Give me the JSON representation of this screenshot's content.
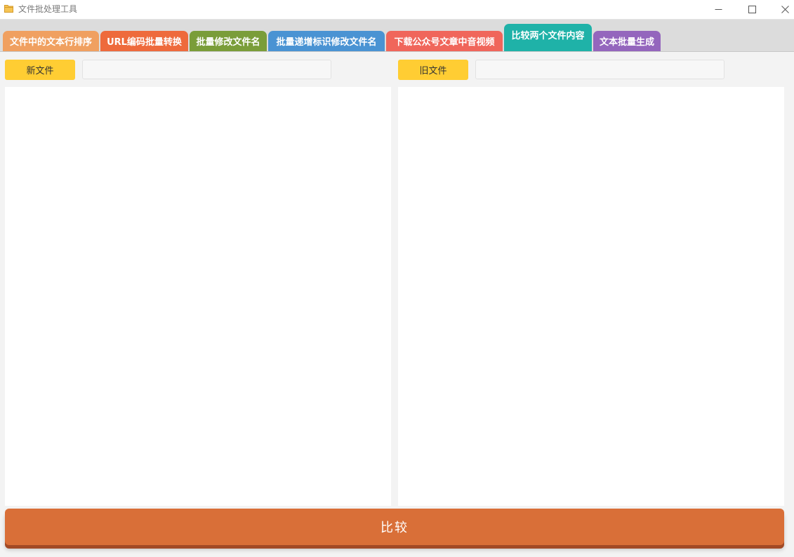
{
  "window": {
    "title": "文件批处理工具",
    "icon": "folder-icon",
    "controls": [
      "minimize-icon",
      "maximize-icon",
      "close-icon"
    ]
  },
  "tabs": [
    {
      "label": "文件中的文本行排序",
      "color": "#f0a060",
      "active": false
    },
    {
      "label": "URL编码批量转换",
      "color": "#ee6a3c",
      "active": false
    },
    {
      "label": "批量修改文件名",
      "color": "#7a9d39",
      "active": false
    },
    {
      "label": "批量递增标识修改文件名",
      "color": "#4a93d3",
      "active": false
    },
    {
      "label": "下载公众号文章中音视频",
      "color": "#f0665b",
      "active": false
    },
    {
      "label": "比较两个文件内容",
      "color": "#1fb2a8",
      "active": true
    },
    {
      "label": "文本批量生成",
      "color": "#9466bd",
      "active": false
    }
  ],
  "left": {
    "button_label": "新文件",
    "path_value": "",
    "content": ""
  },
  "right": {
    "button_label": "旧文件",
    "path_value": "",
    "content": ""
  },
  "compare": {
    "label": "比较",
    "color": "#d96f38"
  },
  "colors": {
    "file_button": "#ffcd33",
    "background": "#f3f3f3",
    "tabstrip": "#dcdcdc"
  }
}
